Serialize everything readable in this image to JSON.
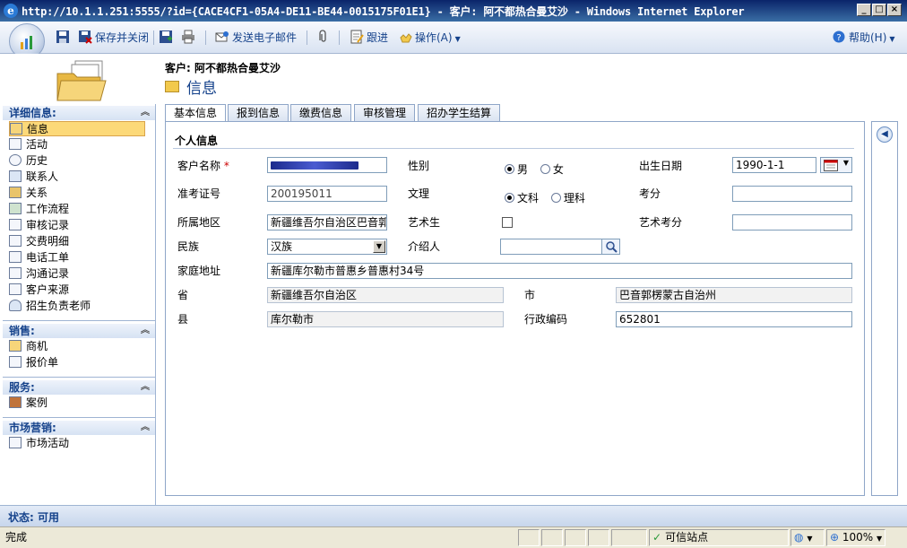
{
  "window": {
    "title": "http://10.1.1.251:5555/?id={CACE4CF1-05A4-DE11-BE44-0015175F01E1} - 客户: 阿不都热合曼艾沙 - Windows Internet Explorer"
  },
  "toolbar": {
    "save_close": "保存并关闭",
    "send_email": "发送电子邮件",
    "follow_up": "跟进",
    "actions": "操作(A)",
    "help": "帮助(H)"
  },
  "header": {
    "customer": "客户: 阿不都热合曼艾沙",
    "title": "信息"
  },
  "leftnav": {
    "groups": [
      {
        "title": "详细信息:",
        "items": [
          "信息",
          "活动",
          "历史",
          "联系人",
          "关系",
          "工作流程",
          "审核记录",
          "交费明细",
          "电话工单",
          "沟通记录",
          "客户来源",
          "招生负责老师"
        ]
      },
      {
        "title": "销售:",
        "items": [
          "商机",
          "报价单"
        ]
      },
      {
        "title": "服务:",
        "items": [
          "案例"
        ]
      },
      {
        "title": "市场营销:",
        "items": [
          "市场活动"
        ]
      }
    ]
  },
  "tabs": [
    "基本信息",
    "报到信息",
    "缴费信息",
    "审核管理",
    "招办学生结算"
  ],
  "form": {
    "section": "个人信息",
    "labels": {
      "name": "客户名称",
      "gender": "性别",
      "birth": "出生日期",
      "exam_no": "准考证号",
      "subject": "文理",
      "score": "考分",
      "region": "所属地区",
      "art": "艺术生",
      "art_score": "艺术考分",
      "ethnic": "民族",
      "referrer": "介绍人",
      "address": "家庭地址",
      "province": "省",
      "city": "市",
      "county": "县",
      "admin_code": "行政编码"
    },
    "required_mark": "*",
    "gender_options": [
      "男",
      "女"
    ],
    "gender_selected": "男",
    "subject_options": [
      "文科",
      "理科"
    ],
    "subject_selected": "文科",
    "values": {
      "birth": "1990-1-1",
      "exam_no": "200195011",
      "region": "新疆维吾尔自治区巴音郭",
      "ethnic": "汉族",
      "address": "新疆库尔勒市普惠乡普惠村34号",
      "province": "新疆维吾尔自治区",
      "city": "巴音郭楞蒙古自治州",
      "county": "库尔勒市",
      "admin_code": "652801"
    }
  },
  "status": {
    "app": "状态: 可用",
    "ie_done": "完成",
    "trusted": "可信站点",
    "zoom": "100%"
  }
}
